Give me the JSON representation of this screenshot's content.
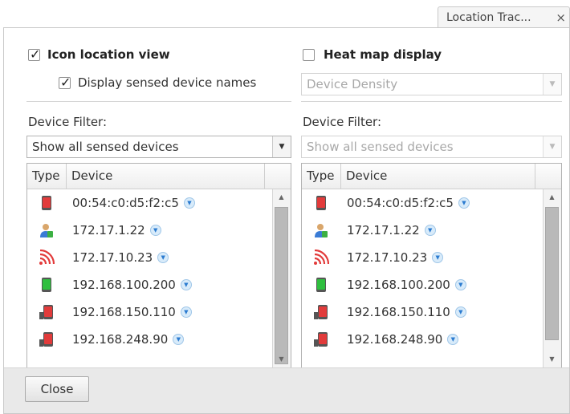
{
  "tab": {
    "label": "Location Trac...",
    "close_glyph": "×"
  },
  "left": {
    "icon_location": {
      "label": "Icon location view",
      "checked": true
    },
    "display_names": {
      "label": "Display sensed device names",
      "checked": true
    },
    "filter_label": "Device Filter:",
    "filter_value": "Show all sensed devices",
    "columns": [
      "Type",
      "Device"
    ],
    "rows": [
      {
        "device": "00:54:c0:d5:f2:c5",
        "icon": "red-phone-icon"
      },
      {
        "device": "172.17.1.22",
        "icon": "person-icon"
      },
      {
        "device": "172.17.10.23",
        "icon": "wifi-signal-icon"
      },
      {
        "device": "192.168.100.200",
        "icon": "green-phone-icon"
      },
      {
        "device": "192.168.150.110",
        "icon": "sensed-phone-icon"
      },
      {
        "device": "192.168.248.90",
        "icon": "sensed-phone-icon"
      }
    ]
  },
  "right": {
    "heat_map": {
      "label": "Heat map display",
      "checked": false
    },
    "density_value": "Device Density",
    "filter_label": "Device Filter:",
    "filter_value": "Show all sensed devices",
    "columns": [
      "Type",
      "Device"
    ],
    "rows": [
      {
        "device": "00:54:c0:d5:f2:c5",
        "icon": "red-phone-icon"
      },
      {
        "device": "172.17.1.22",
        "icon": "person-icon"
      },
      {
        "device": "172.17.10.23",
        "icon": "wifi-signal-icon"
      },
      {
        "device": "192.168.100.200",
        "icon": "green-phone-icon"
      },
      {
        "device": "192.168.150.110",
        "icon": "sensed-phone-icon"
      },
      {
        "device": "192.168.248.90",
        "icon": "sensed-phone-icon"
      }
    ]
  },
  "footer": {
    "close_label": "Close"
  },
  "colors": {
    "accent": "#2b7bd0",
    "red": "#e23b3b",
    "green": "#2fbf3f",
    "footer_bg": "#e9e9e9"
  }
}
